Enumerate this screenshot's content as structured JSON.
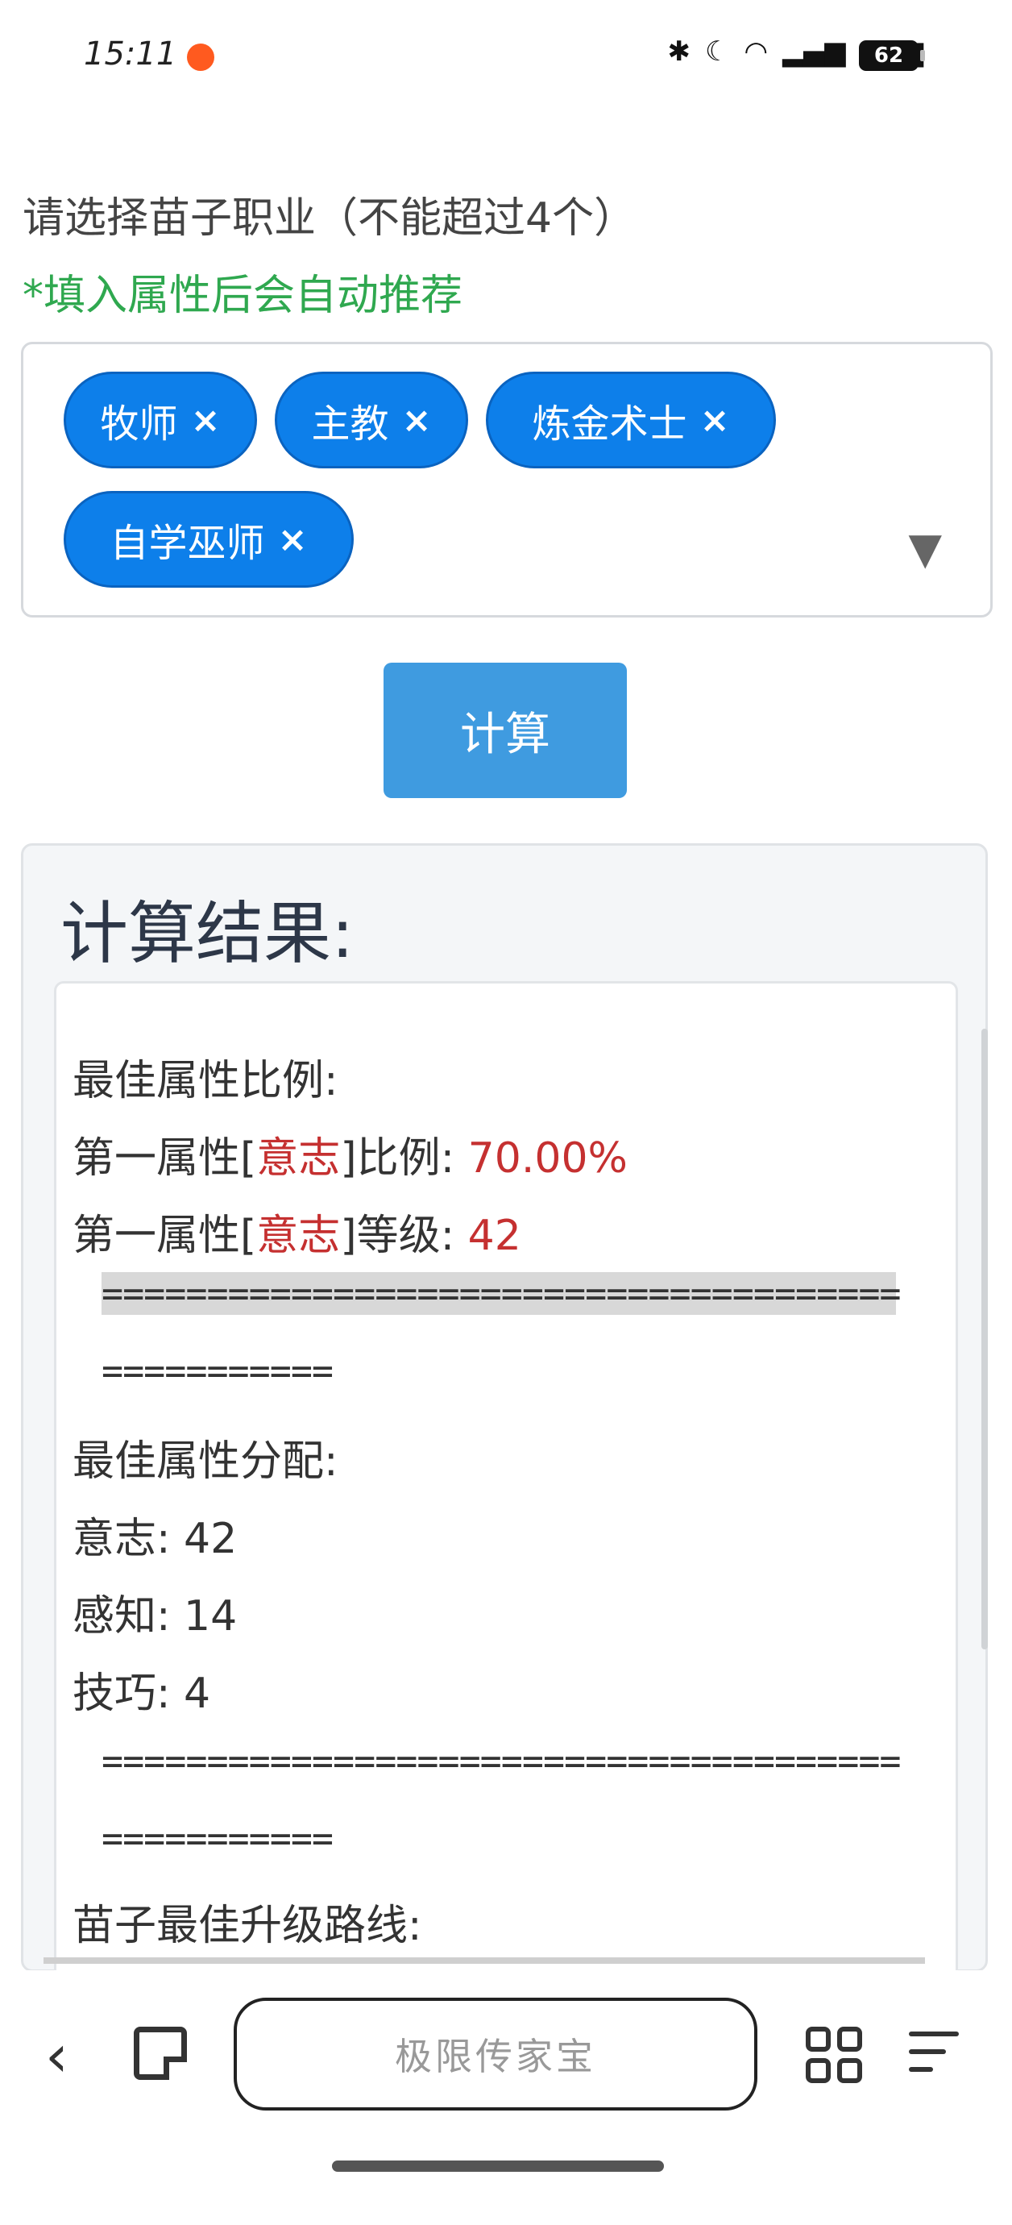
{
  "status_bar": {
    "time": "15:11",
    "battery": "62",
    "icons": [
      "bluetooth-icon",
      "moon-icon",
      "wifi-icon",
      "signal-5g-icon",
      "signal-5g-icon"
    ]
  },
  "page": {
    "heading": "请选择苗子职业（不能超过4个）",
    "hint": "*填入属性后会自动推荐"
  },
  "selected_jobs": [
    {
      "label": "牧师",
      "remove": "×"
    },
    {
      "label": "主教",
      "remove": "×"
    },
    {
      "label": "炼金术士",
      "remove": "×"
    },
    {
      "label": "自学巫师",
      "remove": "×"
    }
  ],
  "dropdown_arrow": "▼",
  "calc_button": "计算",
  "result": {
    "title": "计算结果:",
    "best_ratio_label": "最佳属性比例:",
    "primary_ratio_pre": "第一属性[",
    "primary_attr": "意志",
    "primary_ratio_post": "]比例: ",
    "primary_ratio_value": "70.00%",
    "primary_level_pre": "第一属性[",
    "primary_level_post": "]等级: ",
    "primary_level_value": "42",
    "separator_a": "======================================",
    "separator_b": "===========",
    "best_alloc_label": "最佳属性分配:",
    "alloc": [
      {
        "text": "意志: 42"
      },
      {
        "text": "感知: 14"
      },
      {
        "text": "技巧: 4"
      }
    ],
    "route_label": "苗子最佳升级路线:"
  },
  "navbar": {
    "address_text": "极限传家宝",
    "back": "‹"
  },
  "colors": {
    "chip": "#0d7fea",
    "button": "#3f9be0",
    "hint": "#2fa84f",
    "highlight": "#c53030"
  }
}
